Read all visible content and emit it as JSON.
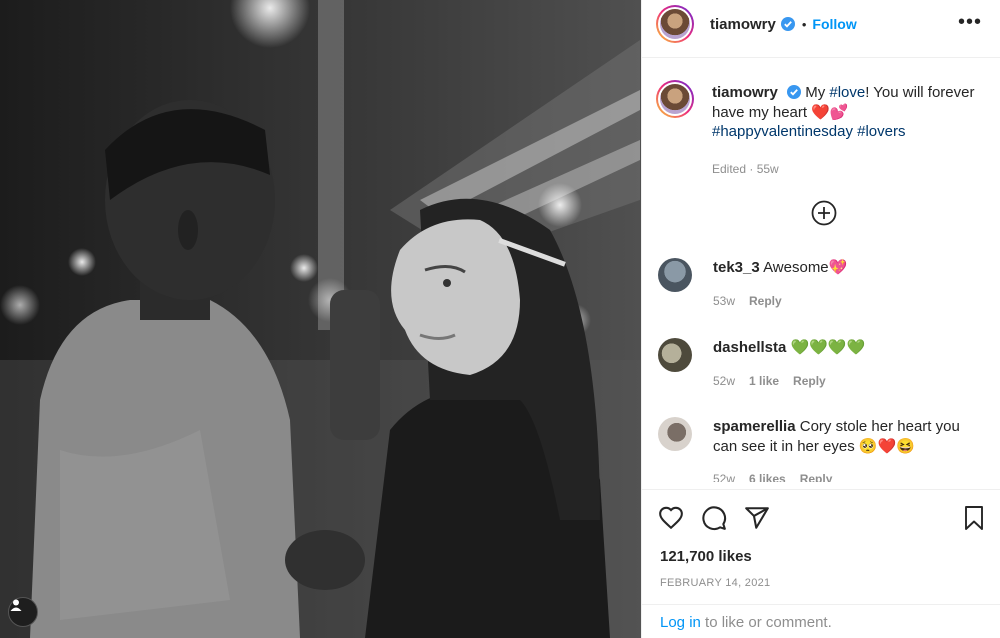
{
  "post": {
    "username": "tiamowry",
    "follow_label": "Follow",
    "dot": "•",
    "more_label": "•••"
  },
  "caption": {
    "username": "tiamowry",
    "text_1": "My ",
    "tag_love": "#love",
    "text_2": "! You will forever have my heart ",
    "emoji": "❤️💕",
    "hashtags": "#happyvalentinesday #lovers",
    "meta": "Edited · 55w"
  },
  "comments": [
    {
      "username": "tek3_3",
      "text": "Awesome💖",
      "time": "53w",
      "likes": "",
      "reply": "Reply"
    },
    {
      "username": "dashellsta",
      "text": "💚💚💚💚",
      "time": "52w",
      "likes": "1 like",
      "reply": "Reply"
    },
    {
      "username": "spamerellia",
      "text": "Cory stole her heart you can see it in her eyes 🥺❤️😆",
      "time": "52w",
      "likes": "6 likes",
      "reply": "Reply"
    }
  ],
  "stats": {
    "likes": "121,700 likes",
    "date": "FEBRUARY 14, 2021"
  },
  "login": {
    "link": "Log in",
    "rest": " to like or comment."
  },
  "icons": [
    "user-tag-icon",
    "verified-icon",
    "more-icon",
    "add-comment-icon",
    "heart-icon",
    "comment-icon",
    "share-icon",
    "bookmark-icon"
  ],
  "colors": {
    "accent": "#0095f6",
    "hashtag": "#00376b",
    "muted": "#8e8e8e"
  }
}
